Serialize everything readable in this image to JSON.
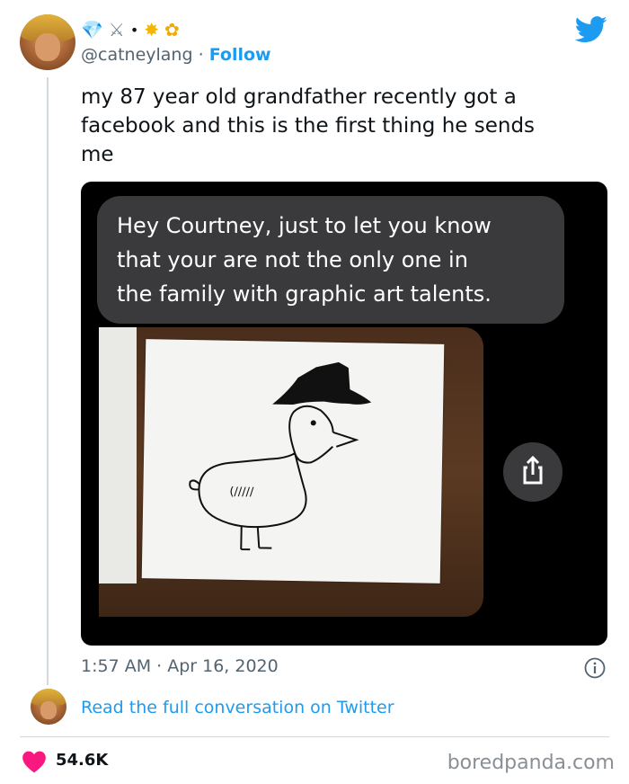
{
  "author": {
    "emoji_row": [
      "💎",
      "⚔",
      "•",
      "✸",
      "✿"
    ],
    "handle": "@catneylang",
    "separator": "·",
    "follow_label": "Follow"
  },
  "tweet": {
    "text": "my 87 year old grandfather recently got a\nfacebook and this is the first thing he sends\nme",
    "timestamp": "1:57 AM · Apr 16, 2020",
    "read_conversation_label": "Read the full conversation on Twitter",
    "likes": "54.6K"
  },
  "media": {
    "message_text": "Hey Courtney, just to let you know\nthat your are not the only one in\nthe family with graphic art talents.",
    "drawing_wing_scribble": "(/////"
  },
  "footer": {
    "watermark": "boredpanda.com"
  },
  "colors": {
    "accent": "#1d9bf0",
    "text": "#0f1419",
    "muted": "#536471",
    "like": "#f91880"
  },
  "icons": [
    "twitter-bird-icon",
    "info-icon",
    "heart-icon",
    "share-icon"
  ]
}
